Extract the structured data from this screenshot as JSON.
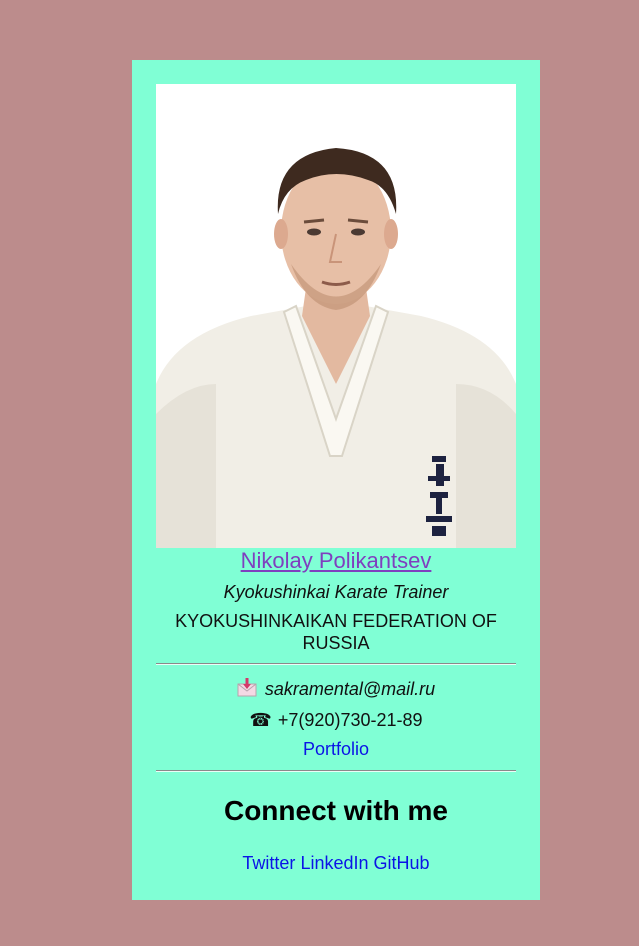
{
  "profile": {
    "name": "Nikolay Polikantsev",
    "role": "Kyokushinkai Karate Trainer",
    "organization": "KYOKUSHINKAIKAN FEDERATION OF RUSSIA",
    "photo_icon": "portrait-photo"
  },
  "contact": {
    "email": "sakramental@mail.ru",
    "email_icon": "envelope-download-icon",
    "phone": "+7(920)730-21-89",
    "phone_icon": "telephone-icon",
    "portfolio_label": "Portfolio"
  },
  "connect": {
    "heading": "Connect with me",
    "links": [
      "Twitter",
      "LinkedIn",
      "GitHub"
    ]
  },
  "colors": {
    "page_background": "#bc8c8c",
    "card_background": "#80ffd5",
    "link": "#0b14e6",
    "visited_link": "#7f3fbf"
  }
}
